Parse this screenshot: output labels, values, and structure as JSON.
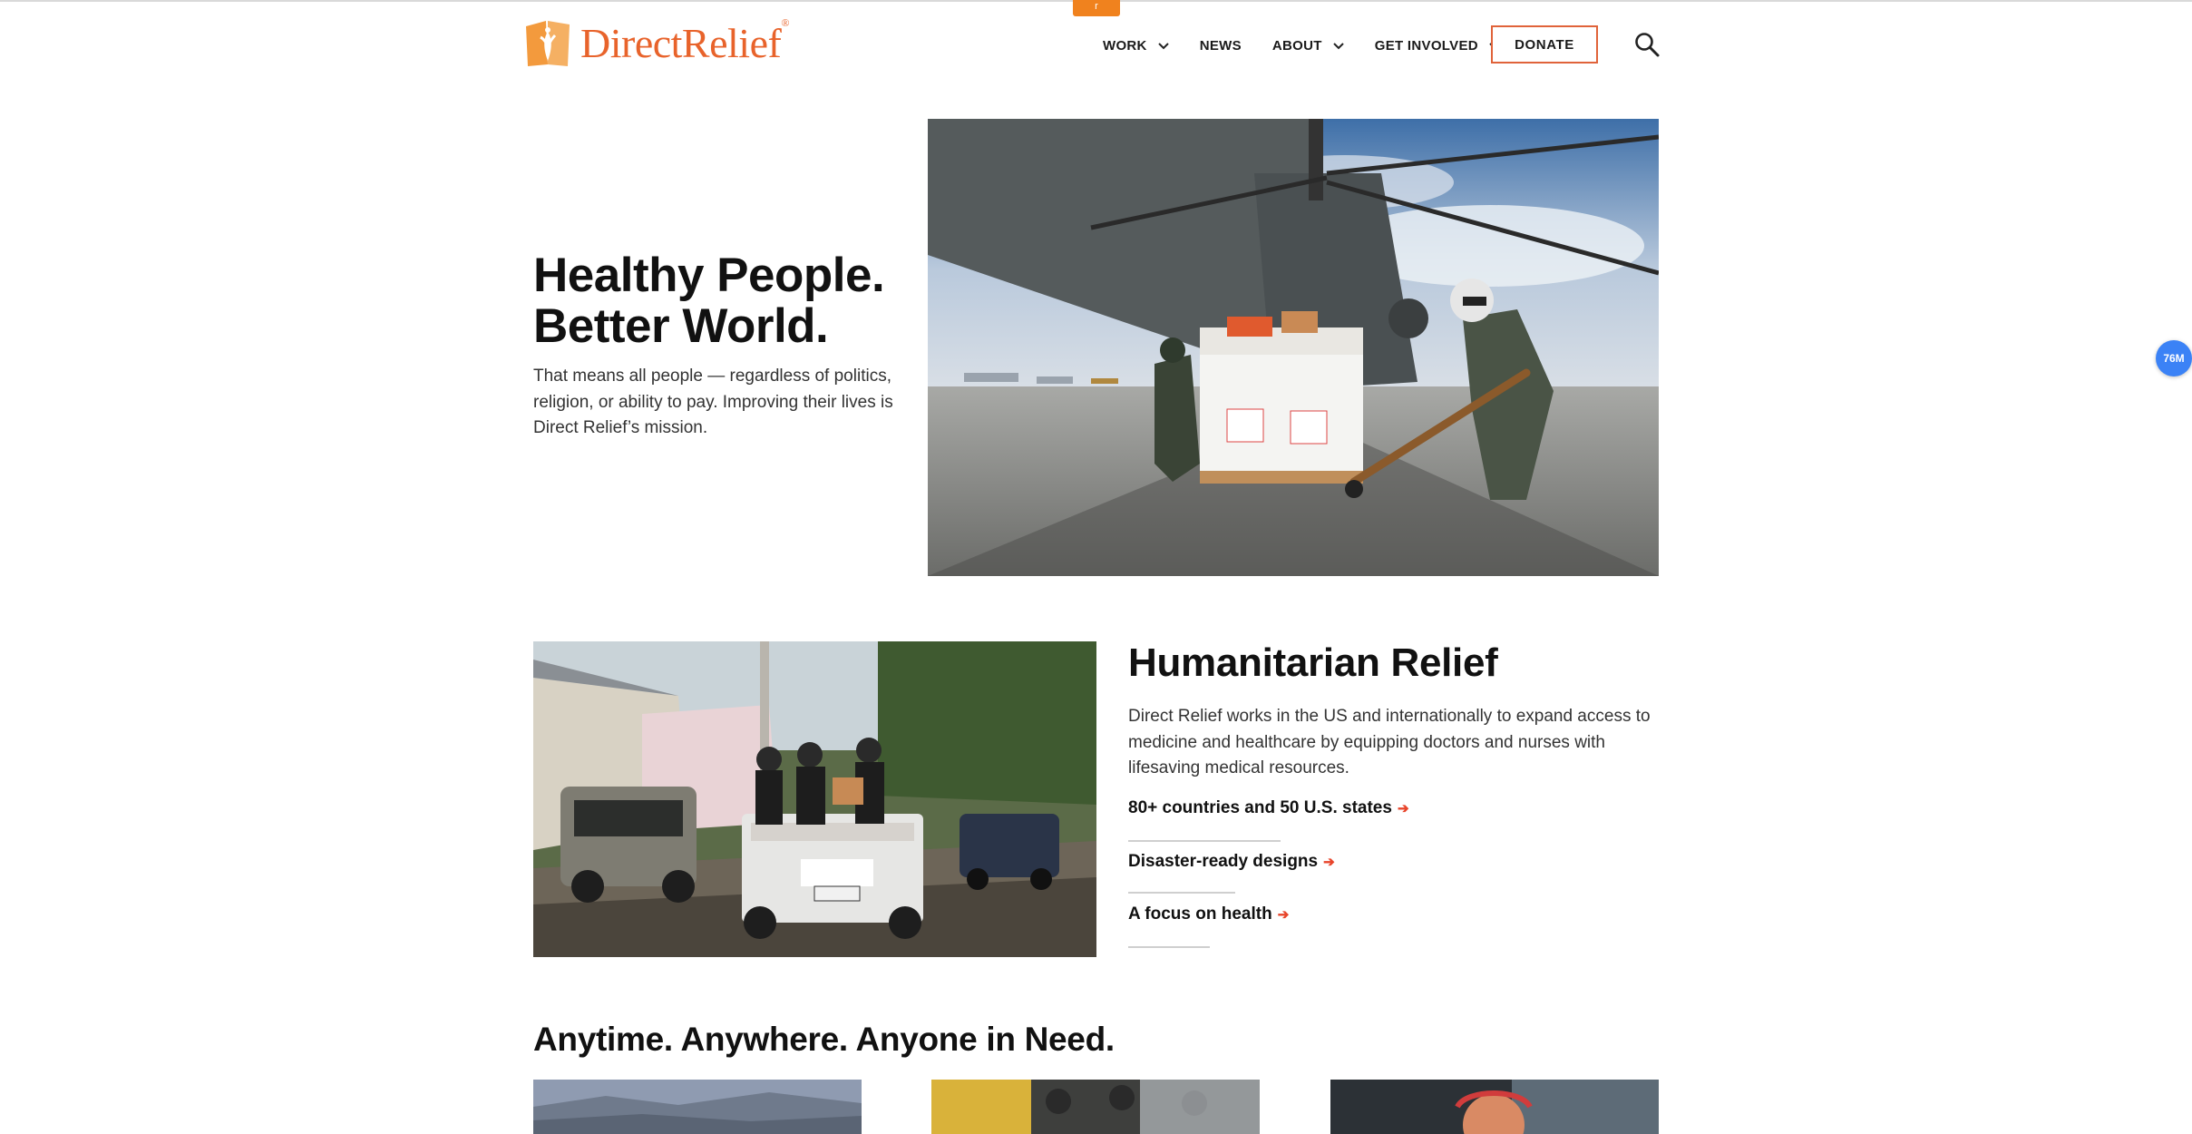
{
  "top_tab": {
    "label": "r"
  },
  "logo": {
    "text": "DirectRelief",
    "mark": "®"
  },
  "nav": {
    "items": [
      {
        "label": "WORK",
        "has_dropdown": true
      },
      {
        "label": "NEWS",
        "has_dropdown": false
      },
      {
        "label": "ABOUT",
        "has_dropdown": true
      },
      {
        "label": "GET INVOLVED",
        "has_dropdown": true
      }
    ],
    "donate_label": "DONATE",
    "search_icon": "search-icon"
  },
  "hero": {
    "title_line1": "Healthy People.",
    "title_line2": "Better World.",
    "text": "That means all people — regardless of politics, religion, or ability to pay. Improving their lives is Direct Relief’s mission."
  },
  "relief": {
    "title": "Humanitarian Relief",
    "text": "Direct Relief works in the US and internationally to expand access to medicine and healthcare by equipping doctors and nurses with lifesaving medical resources.",
    "links": [
      {
        "label": "80+ countries and 50 U.S. states"
      },
      {
        "label": "Disaster-ready designs"
      },
      {
        "label": "A focus on health"
      }
    ]
  },
  "section3": {
    "title": "Anytime. Anywhere. Anyone in Need."
  },
  "side_badge": {
    "label": "76M"
  },
  "colors": {
    "brand": "#e8632b",
    "arrow": "#e8452b",
    "badge": "#3b82f6"
  }
}
